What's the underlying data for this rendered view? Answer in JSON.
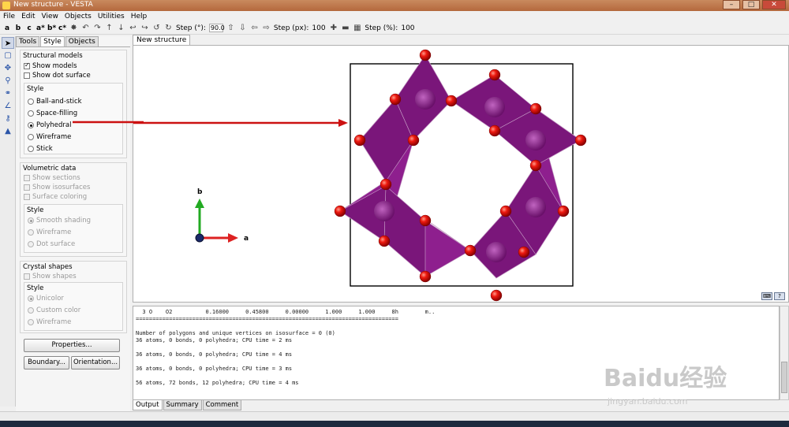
{
  "window": {
    "title": "New structure - VESTA"
  },
  "menu": [
    "File",
    "Edit",
    "View",
    "Objects",
    "Utilities",
    "Help"
  ],
  "toolbar": {
    "axes": [
      "a",
      "b",
      "c",
      "a*",
      "b*",
      "c*"
    ],
    "step_deg_label": "Step (°):",
    "step_deg_value": "90.0",
    "step_px_label": "Step (px):",
    "step_px_value": "100",
    "step_pct_label": "Step (%):",
    "step_pct_value": "100"
  },
  "panel": {
    "tabs": [
      "Tools",
      "Style",
      "Objects"
    ],
    "structural_models": {
      "title": "Structural models",
      "show_models": "Show models",
      "show_dot_surface": "Show dot surface",
      "style_title": "Style",
      "styles": [
        "Ball-and-stick",
        "Space-filling",
        "Polyhedral",
        "Wireframe",
        "Stick"
      ]
    },
    "volumetric": {
      "title": "Volumetric data",
      "show_sections": "Show sections",
      "show_isosurfaces": "Show isosurfaces",
      "surface_coloring": "Surface coloring",
      "style_title": "Style",
      "styles": [
        "Smooth shading",
        "Wireframe",
        "Dot surface"
      ]
    },
    "crystal": {
      "title": "Crystal shapes",
      "show_shapes": "Show shapes",
      "style_title": "Style",
      "styles": [
        "Unicolor",
        "Custom color",
        "Wireframe"
      ]
    },
    "buttons": {
      "properties": "Properties...",
      "boundary": "Boundary...",
      "orientation": "Orientation..."
    }
  },
  "viewport": {
    "tab": "New structure",
    "axis_a": "a",
    "axis_b": "b",
    "colors": {
      "polyhedra": "#8e1f8e",
      "atoms": "#dd1111",
      "cell": "#000000",
      "arrow": "#cc1111",
      "axis_a": "#dd2222",
      "axis_b": "#22aa22",
      "origin": "#1a2a6a"
    }
  },
  "output": {
    "lines": [
      "  3 O    O2          0.16000     0.45800     0.00000     1.000     1.000     8h        m..",
      "===============================================================================",
      "",
      "Number of polygons and unique vertices on isosurface = 0 (0)",
      "36 atoms, 0 bonds, 0 polyhedra; CPU time = 2 ms",
      "",
      "36 atoms, 0 bonds, 0 polyhedra; CPU time = 4 ms",
      "",
      "36 atoms, 0 bonds, 0 polyhedra; CPU time = 3 ms",
      "",
      "56 atoms, 72 bonds, 12 polyhedra; CPU time = 4 ms"
    ],
    "tabs": [
      "Output",
      "Summary",
      "Comment"
    ]
  },
  "watermark": {
    "text": "Baidu经验",
    "url": "jingyan.baidu.com"
  }
}
